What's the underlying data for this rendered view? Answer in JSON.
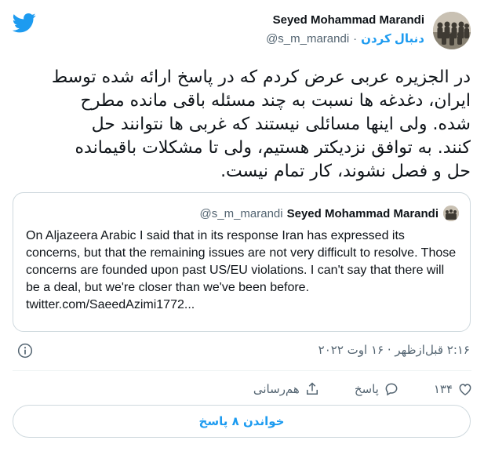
{
  "brand": {
    "icon": "twitter-bird-icon",
    "color": "#1d9bf0"
  },
  "author": {
    "name": "Seyed Mohammad Marandi",
    "handle": "@s_m_marandi",
    "follow_label": "دنبال کردن",
    "avatar": "group-photo-avatar"
  },
  "tweet": {
    "text": "در الجزیره عربی عرض کردم که در پاسخ ارائه شده توسط\nایران، دغدغه ها نسبت به چند مسئله باقی مانده مطرح\nشده. ولی اینها مسائلی نیستند که غربی ها نتوانند حل\nکنند. به توافق نزدیکتر هستیم، ولی تا مشکلات باقیمانده\nحل و فصل نشوند، کار تمام نیست.",
    "timestamp": "۲:۱۶ قبل‌ازظهر · ۱۶ اوت ۲۰۲۲"
  },
  "quote": {
    "name": "Seyed Mohammad Marandi",
    "handle": "@s_m_marandi",
    "text": "On Aljazeera Arabic I said that in its response Iran has expressed its concerns, but that the remaining issues are not very difficult to resolve. Those concerns are founded upon past US/EU violations. I can't say that there will be a deal, but we're closer than we've been before.",
    "link": "twitter.com/SaeedAzimi1772..."
  },
  "actions": {
    "like_count": "۱۳۴",
    "reply_label": "پاسخ",
    "share_label": "هم‌رسانی"
  },
  "read_replies_label": "خواندن ۸ پاسخ",
  "colors": {
    "accent": "#1d9bf0",
    "muted": "#536471",
    "border": "#cfd9de"
  }
}
